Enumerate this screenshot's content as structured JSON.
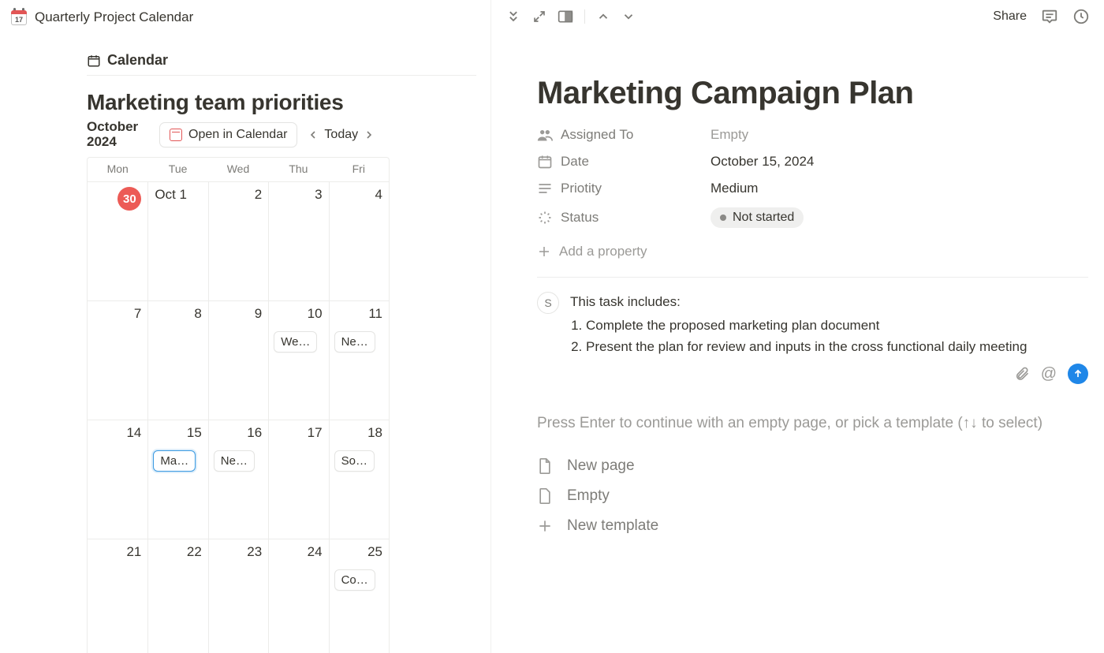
{
  "header": {
    "page_title": "Quarterly Project Calendar",
    "share_label": "Share"
  },
  "left": {
    "tab_label": "Calendar",
    "section_title": "Marketing team priorities",
    "month_label": "October 2024",
    "open_in_calendar": "Open in Calendar",
    "today_label": "Today",
    "dow": [
      "Mon",
      "Tue",
      "Wed",
      "Thu",
      "Fri"
    ],
    "weeks": [
      [
        {
          "num": "30",
          "circle": true,
          "event": null
        },
        {
          "num": "Oct 1",
          "align": "left",
          "event": null
        },
        {
          "num": "2",
          "event": null
        },
        {
          "num": "3",
          "event": null
        },
        {
          "num": "4",
          "event": null
        }
      ],
      [
        {
          "num": "7",
          "event": null
        },
        {
          "num": "8",
          "event": null
        },
        {
          "num": "9",
          "event": null
        },
        {
          "num": "10",
          "event": "We…"
        },
        {
          "num": "11",
          "event": "Ne…"
        }
      ],
      [
        {
          "num": "14",
          "event": null
        },
        {
          "num": "15",
          "event": "Ma…",
          "selected": true
        },
        {
          "num": "16",
          "event": "Ne…"
        },
        {
          "num": "17",
          "event": null
        },
        {
          "num": "18",
          "event": "So…"
        }
      ],
      [
        {
          "num": "21",
          "event": null
        },
        {
          "num": "22",
          "event": null
        },
        {
          "num": "23",
          "event": null
        },
        {
          "num": "24",
          "event": null
        },
        {
          "num": "25",
          "event": "Co…"
        }
      ]
    ]
  },
  "right": {
    "title": "Marketing Campaign Plan",
    "props": {
      "assigned_to": {
        "label": "Assigned To",
        "value": "Empty",
        "empty": true
      },
      "date": {
        "label": "Date",
        "value": "October 15, 2024"
      },
      "priority": {
        "label": "Priotity",
        "value": "Medium"
      },
      "status": {
        "label": "Status",
        "value": "Not started"
      },
      "add_prop": "Add a property"
    },
    "comment": {
      "initial": "S",
      "lead": "This task includes:",
      "items": [
        "Complete the proposed marketing plan document",
        "Present the plan for review and inputs in the cross functional daily meeting"
      ]
    },
    "hint": "Press Enter to continue with an empty page, or pick a template (↑↓ to select)",
    "templates": {
      "new_page": "New page",
      "empty": "Empty",
      "new_template": "New template"
    }
  }
}
